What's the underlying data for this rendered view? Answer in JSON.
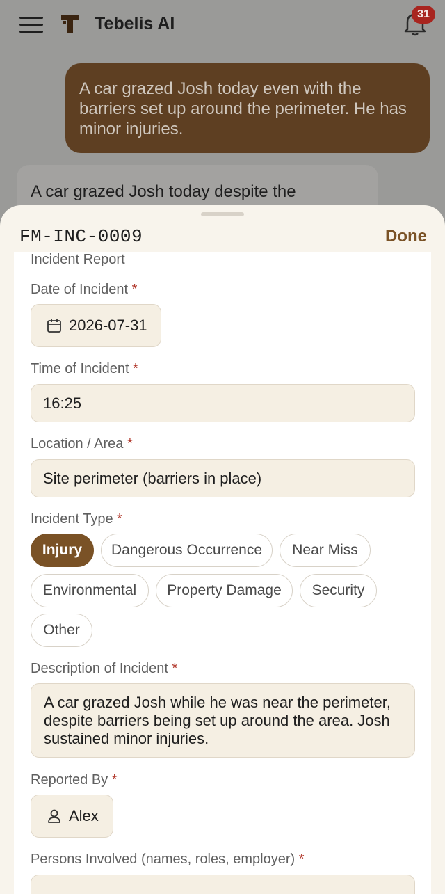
{
  "header": {
    "app_title": "Tebelis AI",
    "notification_count": "31"
  },
  "chat": {
    "user_message": "A car grazed Josh today even with the barriers set up around the perimeter. He has minor injuries.",
    "ai_message": "A car grazed Josh today despite the"
  },
  "sheet": {
    "form_id": "FM-INC-0009",
    "done_label": "Done",
    "section_title": "Incident Report",
    "date_label": "Date of Incident",
    "date_value": "2026-07-31",
    "time_label": "Time of Incident",
    "time_value": "16:25",
    "location_label": "Location / Area",
    "location_value": "Site perimeter (barriers in place)",
    "type_label": "Incident Type",
    "incident_types": [
      "Injury",
      "Dangerous Occurrence",
      "Near Miss",
      "Environmental",
      "Property Damage",
      "Security",
      "Other"
    ],
    "selected_type": "Injury",
    "description_label": "Description of Incident",
    "description_value": "A car grazed Josh while he was near the perimeter, despite barriers being set up around the area. Josh sustained minor injuries.",
    "reported_by_label": "Reported By",
    "reported_by_value": "Alex",
    "persons_label": "Persons Involved (names, roles, employer)",
    "required_marker": "*"
  },
  "colors": {
    "accent": "#7a5226",
    "user_bubble": "#5e3f22",
    "required": "#b23a2e",
    "badge": "#a8251f"
  }
}
